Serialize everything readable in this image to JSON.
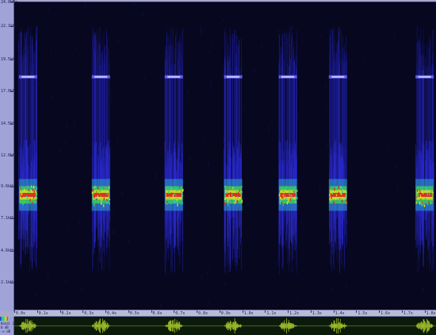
{
  "freq_axis": {
    "labels": [
      "24.0kHz",
      "22.1kHz",
      "19.5kHz",
      "17.0kHz",
      "14.5kHz",
      "12.0kHz",
      "9.6kHz",
      "7.1kHz",
      "4.6kHz",
      "2.1kHz"
    ],
    "label_kHz": [
      24.0,
      22.1,
      19.5,
      17.0,
      14.5,
      12.0,
      9.6,
      7.1,
      4.6,
      2.1
    ]
  },
  "time_axis": {
    "labels": [
      "0.0s",
      "0.1s",
      "0.2s",
      "0.3s",
      "0.4s",
      "0.5s",
      "0.6s",
      "0.7s",
      "0.8s",
      "0.9s",
      "1.0s",
      "1.1s",
      "1.2s",
      "1.3s",
      "1.4s",
      "1.5s",
      "1.6s",
      "1.7s",
      "1.8s"
    ]
  },
  "calls": {
    "start_s": [
      0.02,
      0.34,
      0.66,
      0.92,
      1.16,
      1.38,
      1.76
    ],
    "duration_s": 0.08,
    "peak_freq_kHz": 9.0,
    "harmonic_freq_kHz": 18.2
  },
  "waveform_header": {
    "line1": "Kanal 1",
    "line2": "0 dB",
    "line3": "-∞ dB"
  },
  "colors": {
    "background": "#07071f",
    "low": "#2a2ad0",
    "mid": "#30c0d0",
    "high": "#40e040",
    "peak": "#e02020",
    "waveform": "#b8d830"
  }
}
